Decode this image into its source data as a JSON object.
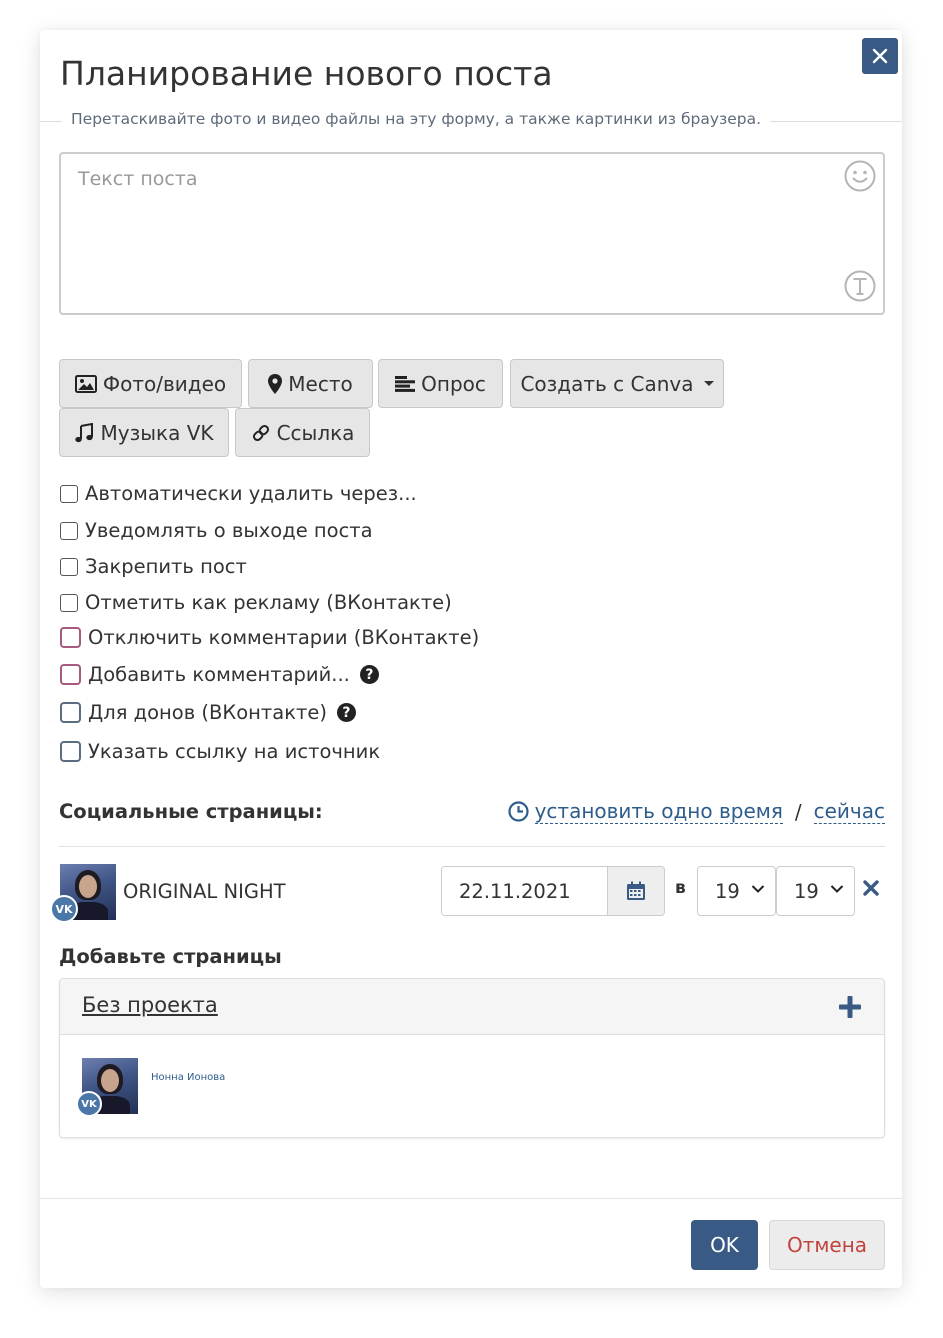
{
  "dialog": {
    "title": "Планирование нового поста",
    "hint": "Перетаскивайте фото и видео файлы на эту форму, а также картинки из браузера.",
    "close_icon": "close-icon"
  },
  "editor": {
    "placeholder": "Текст поста",
    "icons": [
      "smiley-icon",
      "text-format-icon"
    ]
  },
  "attach_buttons": {
    "photo": "Фото/видео",
    "place": "Место",
    "poll": "Опрос",
    "canva": "Создать с Canva",
    "music": "Музыка VK",
    "link": "Ссылка"
  },
  "options": [
    {
      "label": "Автоматически удалить через...",
      "checked": false
    },
    {
      "label": "Уведомлять о выходе поста",
      "checked": false
    },
    {
      "label": "Закрепить пост",
      "checked": false
    },
    {
      "label": "Отметить как рекламу (ВКонтакте)",
      "checked": false
    },
    {
      "label": "Отключить комментарии (ВКонтакте)",
      "checked": false
    },
    {
      "label": "Добавить комментарий...",
      "checked": false
    },
    {
      "label": "Для донов (ВКонтакте)",
      "checked": false
    },
    {
      "label": "Указать ссылку на источник",
      "checked": false
    }
  ],
  "social": {
    "label": "Социальные страницы:",
    "set_one_time": "установить одно время",
    "separator": "/",
    "now": "сейчас",
    "page": {
      "name": "ORIGINAL NIGHT",
      "network_badge": "VK",
      "date": "22.11.2021",
      "at": "в",
      "hour": "19",
      "minute": "19"
    }
  },
  "add_pages": {
    "label": "Добавьте страницы",
    "project_title": "Без проекта",
    "account_name": "Нонна Ионова",
    "network_badge": "VK"
  },
  "footer": {
    "ok": "OK",
    "cancel": "Отмена"
  },
  "colors": {
    "primary": "#3a5a86",
    "link": "#2e5d8c",
    "danger": "#c0443e",
    "vk": "#4a76a8"
  }
}
